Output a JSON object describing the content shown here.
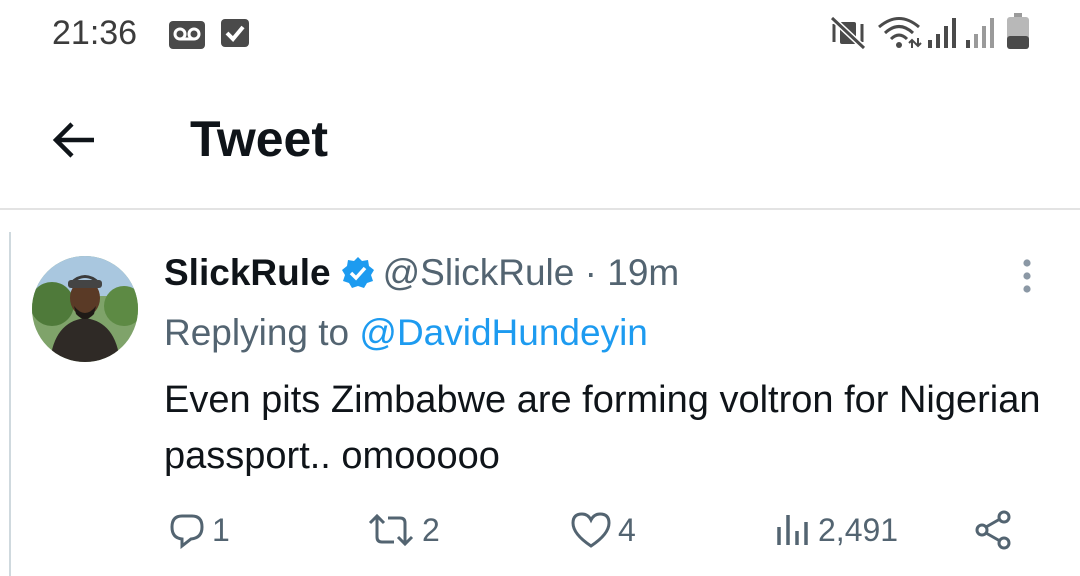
{
  "status_bar": {
    "time": "21:36",
    "icons": [
      "voicemail-icon",
      "checkbox-icon",
      "vibrate-mute-icon",
      "wifi-icon",
      "signal-icon",
      "signal-icon-2",
      "battery-icon"
    ]
  },
  "header": {
    "title": "Tweet",
    "back_icon": "arrow-left-icon"
  },
  "tweet": {
    "author_name": "SlickRule",
    "verified": true,
    "handle": "@SlickRule",
    "separator": "·",
    "time": "19m",
    "replying_prefix": "Replying to",
    "replying_to": "@DavidHundeyin",
    "text": "Even pits Zimbabwe are forming voltron for Nigerian passport.. omooooo",
    "actions": {
      "replies": "1",
      "retweets": "2",
      "likes": "4",
      "views": "2,491"
    }
  },
  "colors": {
    "accent": "#1d9bf0",
    "secondary_text": "#536471",
    "primary_text": "#0f1419"
  }
}
